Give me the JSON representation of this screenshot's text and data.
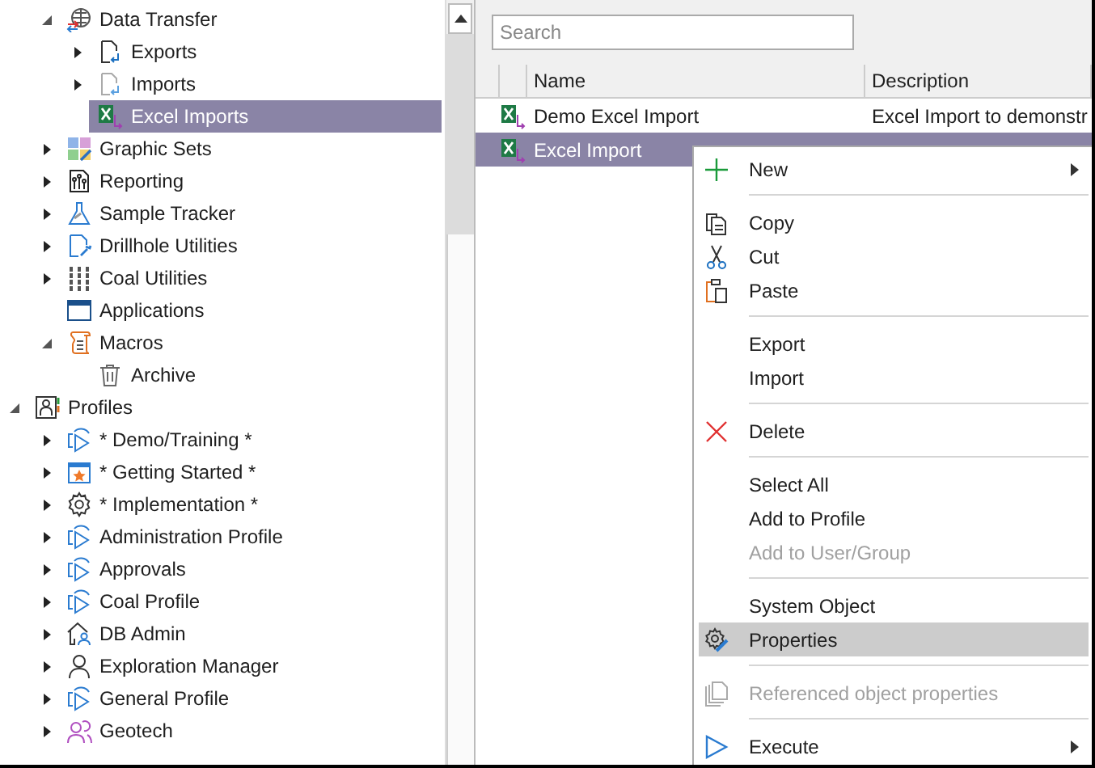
{
  "tree": {
    "items": [
      {
        "children": [
          {
            "label": "Data Transfer",
            "kind": "transfer",
            "expanded": true,
            "selected": false,
            "children": [
              {
                "label": "Exports",
                "kind": "export",
                "expanded": false,
                "selected": false
              },
              {
                "label": "Imports",
                "kind": "import",
                "expanded": false,
                "selected": false
              },
              {
                "label": "Excel Imports",
                "kind": "excel",
                "selected": true
              }
            ]
          },
          {
            "label": "Graphic Sets",
            "kind": "graphic",
            "expanded": false,
            "selected": false
          },
          {
            "label": "Reporting",
            "kind": "report",
            "expanded": false,
            "selected": false
          },
          {
            "label": "Sample Tracker",
            "kind": "flask",
            "expanded": false,
            "selected": false
          },
          {
            "label": "Drillhole Utilities",
            "kind": "drill",
            "expanded": false,
            "selected": false
          },
          {
            "label": "Coal Utilities",
            "kind": "coal",
            "expanded": false,
            "selected": false
          },
          {
            "label": "Applications",
            "kind": "app",
            "selected": false
          },
          {
            "label": "Macros",
            "kind": "macro",
            "expanded": true,
            "selected": false,
            "children": [
              {
                "label": "Archive",
                "kind": "trash",
                "selected": false
              }
            ]
          }
        ]
      },
      {
        "label": "Profiles",
        "kind": "profiles",
        "expanded": true,
        "selected": false,
        "children": [
          {
            "label": "* Demo/Training *",
            "kind": "profile",
            "expanded": false,
            "selected": false
          },
          {
            "label": "* Getting Started *",
            "kind": "star",
            "expanded": false,
            "selected": false
          },
          {
            "label": "* Implementation *",
            "kind": "gear",
            "expanded": false,
            "selected": false
          },
          {
            "label": "Administration Profile",
            "kind": "profile",
            "expanded": false,
            "selected": false
          },
          {
            "label": "Approvals",
            "kind": "profile",
            "expanded": false,
            "selected": false
          },
          {
            "label": "Coal Profile",
            "kind": "profile",
            "expanded": false,
            "selected": false
          },
          {
            "label": "DB Admin",
            "kind": "house",
            "expanded": false,
            "selected": false
          },
          {
            "label": "Exploration Manager",
            "kind": "user",
            "expanded": false,
            "selected": false
          },
          {
            "label": "General Profile",
            "kind": "profile",
            "expanded": false,
            "selected": false
          },
          {
            "label": "Geotech",
            "kind": "users",
            "expanded": false,
            "selected": false
          }
        ]
      }
    ]
  },
  "search": {
    "placeholder": "Search"
  },
  "table": {
    "columns": [
      "Name",
      "Description"
    ],
    "rows": [
      {
        "name": "Demo Excel Import",
        "description": "Excel Import to demonstr",
        "selected": false
      },
      {
        "name": "Excel Import",
        "selected": true
      }
    ]
  },
  "context_menu": {
    "groups": [
      [
        {
          "label": "New",
          "kind": "plus",
          "submenu": true,
          "disabled": false,
          "selected": false
        }
      ],
      [
        {
          "label": "Copy",
          "kind": "copy",
          "disabled": false,
          "selected": false
        },
        {
          "label": "Cut",
          "kind": "cut",
          "disabled": false,
          "selected": false
        },
        {
          "label": "Paste",
          "kind": "paste",
          "disabled": false,
          "selected": false
        }
      ],
      [
        {
          "label": "Export",
          "disabled": false,
          "selected": false
        },
        {
          "label": "Import",
          "disabled": false,
          "selected": false
        }
      ],
      [
        {
          "label": "Delete",
          "kind": "delete",
          "disabled": false,
          "selected": false
        }
      ],
      [
        {
          "label": "Select All",
          "disabled": false,
          "selected": false
        },
        {
          "label": "Add to Profile",
          "disabled": false,
          "selected": false
        },
        {
          "label": "Add to User/Group",
          "disabled": true,
          "selected": false
        }
      ],
      [
        {
          "label": "System Object",
          "disabled": false,
          "selected": false
        },
        {
          "label": "Properties",
          "kind": "properties",
          "disabled": false,
          "selected": true
        }
      ],
      [
        {
          "label": "Referenced object properties",
          "kind": "refcopy",
          "disabled": true,
          "selected": false
        }
      ],
      [
        {
          "label": "Execute",
          "kind": "play",
          "submenu": true,
          "disabled": false,
          "selected": false
        }
      ]
    ]
  }
}
